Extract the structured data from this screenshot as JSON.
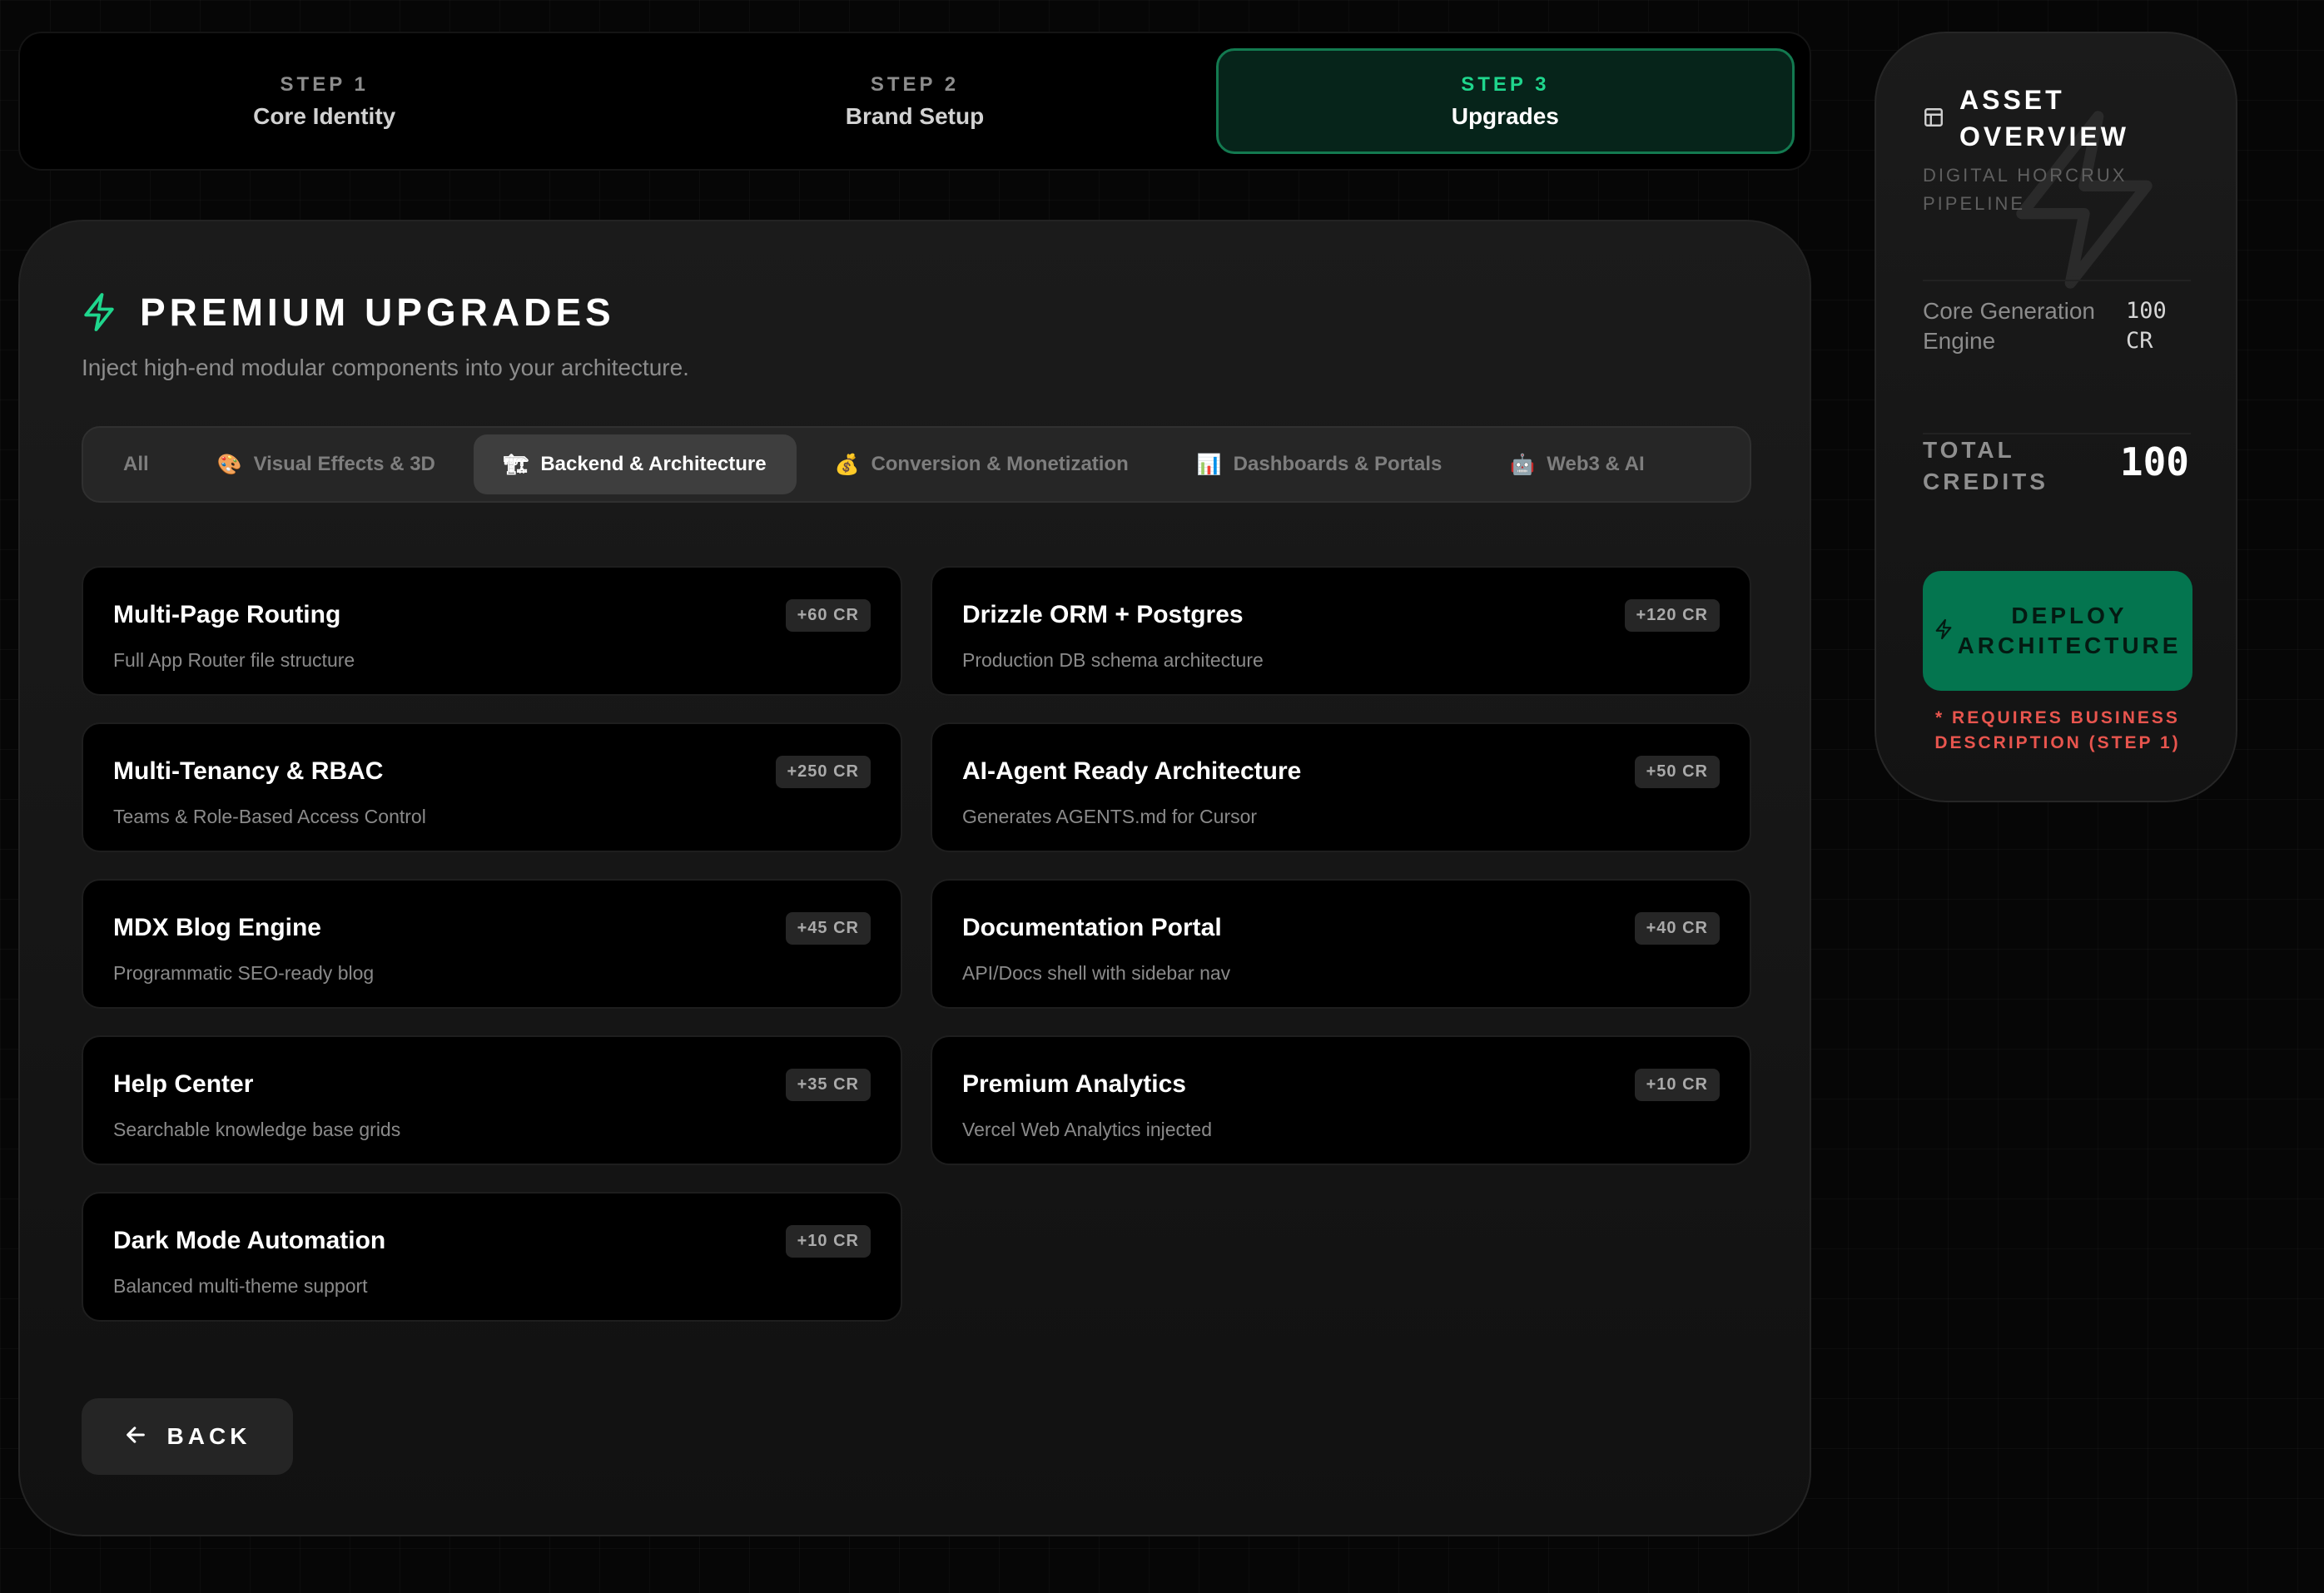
{
  "stepper": {
    "steps": [
      {
        "number": "STEP 1",
        "label": "Core Identity",
        "active": false
      },
      {
        "number": "STEP 2",
        "label": "Brand Setup",
        "active": false
      },
      {
        "number": "STEP 3",
        "label": "Upgrades",
        "active": true
      }
    ]
  },
  "main": {
    "title": "PREMIUM UPGRADES",
    "subtitle": "Inject high-end modular components into your architecture.",
    "tabs": [
      {
        "label": "All",
        "emoji": "",
        "active": false
      },
      {
        "label": "Visual Effects & 3D",
        "emoji": "🎨",
        "active": false
      },
      {
        "label": "Backend & Architecture",
        "emoji": "🏗",
        "active": true
      },
      {
        "label": "Conversion & Monetization",
        "emoji": "💰",
        "active": false
      },
      {
        "label": "Dashboards & Portals",
        "emoji": "📊",
        "active": false
      },
      {
        "label": "Web3 & AI",
        "emoji": "🤖",
        "active": false
      }
    ],
    "cards": [
      {
        "title": "Multi-Page Routing",
        "desc": "Full App Router file structure",
        "cost": "+60 CR"
      },
      {
        "title": "Drizzle ORM + Postgres",
        "desc": "Production DB schema architecture",
        "cost": "+120 CR"
      },
      {
        "title": "Multi-Tenancy & RBAC",
        "desc": "Teams & Role-Based Access Control",
        "cost": "+250 CR"
      },
      {
        "title": "AI-Agent Ready Architecture",
        "desc": "Generates AGENTS.md for Cursor",
        "cost": "+50 CR"
      },
      {
        "title": "MDX Blog Engine",
        "desc": "Programmatic SEO-ready blog",
        "cost": "+45 CR"
      },
      {
        "title": "Documentation Portal",
        "desc": "API/Docs shell with sidebar nav",
        "cost": "+40 CR"
      },
      {
        "title": "Help Center",
        "desc": "Searchable knowledge base grids",
        "cost": "+35 CR"
      },
      {
        "title": "Premium Analytics",
        "desc": "Vercel Web Analytics injected",
        "cost": "+10 CR"
      },
      {
        "title": "Dark Mode Automation",
        "desc": "Balanced multi-theme support",
        "cost": "+10 CR"
      }
    ],
    "back_label": "BACK"
  },
  "sidebar": {
    "title_line1": "ASSET",
    "title_line2": "OVERVIEW",
    "subtitle": "DIGITAL HORCRUX PIPELINE",
    "line_item": {
      "label": "Core Generation Engine",
      "value": "100 CR"
    },
    "total_label_line1": "TOTAL",
    "total_label_line2": "CREDITS",
    "total_value": "100",
    "deploy_line1": "DEPLOY",
    "deploy_line2": "ARCHITECTURE",
    "note": "* REQUIRES BUSINESS DESCRIPTION (STEP 1)"
  },
  "colors": {
    "accent": "#1fd68d",
    "deploy_bg": "#04754f",
    "warning": "#e8554e",
    "background": "#060606"
  },
  "icons": {
    "title": "bolt-icon",
    "back": "arrow-left-icon",
    "overview": "layout-icon",
    "deploy": "bolt-icon"
  }
}
